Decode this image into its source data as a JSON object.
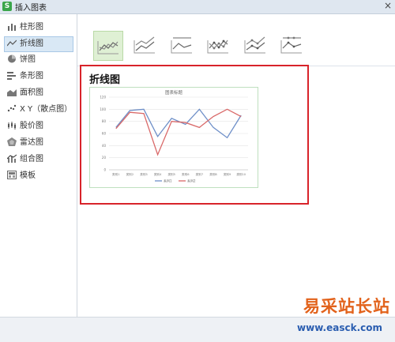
{
  "window": {
    "title": "插入图表",
    "app_icon_letter": "S",
    "close_glyph": "×"
  },
  "sidebar": {
    "items": [
      {
        "label": "柱形图",
        "icon": "column-chart-icon"
      },
      {
        "label": "折线图",
        "icon": "line-chart-icon",
        "active": true
      },
      {
        "label": "饼图",
        "icon": "pie-chart-icon"
      },
      {
        "label": "条形图",
        "icon": "bar-chart-icon"
      },
      {
        "label": "面积图",
        "icon": "area-chart-icon"
      },
      {
        "label": "X Y（散点图）",
        "icon": "scatter-chart-icon"
      },
      {
        "label": "股价图",
        "icon": "stock-chart-icon"
      },
      {
        "label": "雷达图",
        "icon": "radar-chart-icon"
      },
      {
        "label": "组合图",
        "icon": "combo-chart-icon"
      },
      {
        "label": "模板",
        "icon": "template-icon"
      }
    ]
  },
  "variants": [
    {
      "name": "line",
      "selected": true
    },
    {
      "name": "stacked-line"
    },
    {
      "name": "percent-stacked-line"
    },
    {
      "name": "line-with-markers"
    },
    {
      "name": "stacked-line-with-markers"
    },
    {
      "name": "percent-stacked-line-with-markers"
    }
  ],
  "preview": {
    "heading": "折线图",
    "chart_title": "图表标题",
    "legend": [
      "系列1",
      "系列2"
    ]
  },
  "colors": {
    "series1": "#6e8fc8",
    "series2": "#d96868",
    "highlight": "#d8232a",
    "selected_variant": "#dff0d4"
  },
  "watermark": {
    "line1": "易采站长站",
    "line2": "www.easck.com"
  },
  "chart_data": {
    "type": "line",
    "title": "图表标题",
    "categories": [
      "类别1",
      "类别2",
      "类别3",
      "类别4",
      "类别5",
      "类别6",
      "类别7",
      "类别8",
      "类别9",
      "类别10"
    ],
    "series": [
      {
        "name": "系列1",
        "values": [
          70,
          98,
          100,
          55,
          85,
          75,
          100,
          70,
          53,
          90
        ]
      },
      {
        "name": "系列2",
        "values": [
          68,
          95,
          93,
          25,
          80,
          78,
          70,
          88,
          100,
          88
        ]
      }
    ],
    "ylim": [
      0,
      120
    ],
    "yticks": [
      0,
      20,
      40,
      60,
      80,
      100,
      120
    ],
    "grid": true,
    "legend_position": "bottom"
  }
}
